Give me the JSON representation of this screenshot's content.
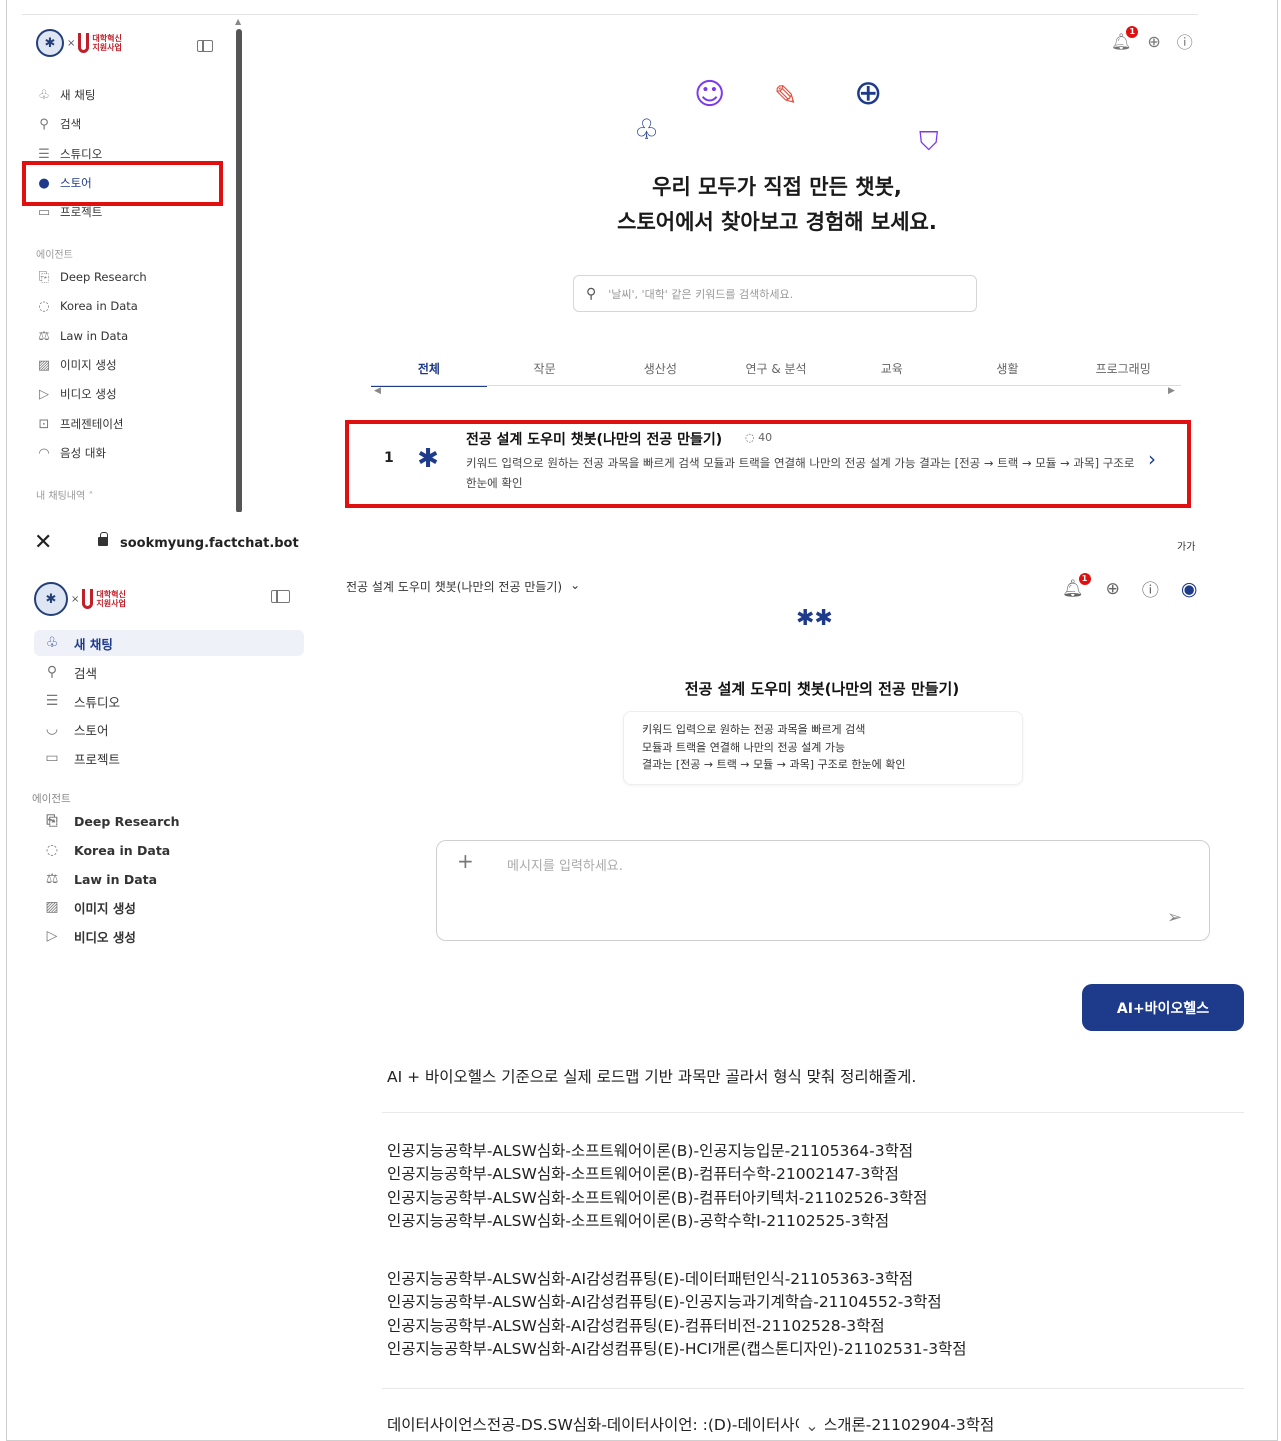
{
  "top_screen": {
    "sidebar": {
      "logo_text": "대학혁신\n지원사업",
      "items": [
        {
          "label": "새 채팅",
          "icon": "new-chat-icon"
        },
        {
          "label": "검색",
          "icon": "search-icon"
        },
        {
          "label": "스튜디오",
          "icon": "studio-icon"
        },
        {
          "label": "스토어",
          "icon": "store-icon",
          "active": true
        },
        {
          "label": "프로젝트",
          "icon": "folder-icon"
        }
      ],
      "agents_section": "에이전트",
      "agents": [
        {
          "label": "Deep Research",
          "icon": "deep-research-icon"
        },
        {
          "label": "Korea in Data",
          "icon": "korea-data-icon"
        },
        {
          "label": "Law in Data",
          "icon": "scale-icon"
        },
        {
          "label": "이미지 생성",
          "icon": "image-icon"
        },
        {
          "label": "비디오 생성",
          "icon": "video-icon"
        },
        {
          "label": "프레젠테이션",
          "icon": "presentation-icon"
        },
        {
          "label": "음성 대화",
          "icon": "voice-icon"
        }
      ],
      "history_section": "내 채팅내역"
    },
    "notification_count": "1",
    "hero_line1": "우리 모두가 직접 만든 챗봇,",
    "hero_line2": "스토어에서 찾아보고 경험해 보세요.",
    "search_placeholder": "'날씨', '대학' 같은 키워드를 검색하세요.",
    "tabs": [
      "전체",
      "작문",
      "생산성",
      "연구 & 분석",
      "교육",
      "생활",
      "프로그래밍"
    ],
    "result": {
      "rank": "1",
      "title": "전공 설계 도우미 챗봇(나만의 전공 만들기)",
      "count": "40",
      "description": "키워드 입력으로 원하는 전공 과목을 빠르게 검색 모듈과 트랙을 연결해 나만의 전공 설계 가능 결과는 [전공 → 트랙 → 모듈 → 과목] 구조로 한눈에 확인"
    }
  },
  "browser": {
    "url": "sookmyung.factchat.bot",
    "text_size_label": "가가"
  },
  "bottom_screen": {
    "sidebar": {
      "logo_text": "대학혁신\n지원사업",
      "items": [
        {
          "label": "새 채팅",
          "icon": "new-chat-icon",
          "active": true
        },
        {
          "label": "검색",
          "icon": "search-icon"
        },
        {
          "label": "스튜디오",
          "icon": "studio-icon"
        },
        {
          "label": "스토어",
          "icon": "store-icon"
        },
        {
          "label": "프로젝트",
          "icon": "folder-icon"
        }
      ],
      "agents_section": "에이전트",
      "agents": [
        {
          "label": "Deep Research",
          "icon": "deep-research-icon"
        },
        {
          "label": "Korea in Data",
          "icon": "korea-data-icon"
        },
        {
          "label": "Law in Data",
          "icon": "scale-icon"
        },
        {
          "label": "이미지 생성",
          "icon": "image-icon"
        },
        {
          "label": "비디오 생성",
          "icon": "video-icon"
        }
      ]
    },
    "header_title": "전공 설계 도우미 챗봇(나만의 전공 만들기)",
    "notification_count": "1",
    "bot_title": "전공 설계 도우미 챗봇(나만의 전공 만들기)",
    "bot_description": [
      "키워드 입력으로 원하는 전공 과목을 빠르게 검색",
      "모듈과 트랙을 연결해 나만의 전공 설계 가능",
      "결과는 [전공 → 트랙 → 모듈 → 과목] 구조로 한눈에 확인"
    ],
    "composer_placeholder": "메시지를 입력하세요.",
    "user_message": "AI+바이오헬스",
    "answer_intro": "AI + 바이오헬스 기준으로 실제 로드맵 기반 과목만 골라서 형식 맞춰 정리해줄게.",
    "course_group_1": [
      "인공지능공학부-ALSW심화-소프트웨어이론(B)-인공지능입문-21105364-3학점",
      "인공지능공학부-ALSW심화-소프트웨어이론(B)-컴퓨터수학-21002147-3학점",
      "인공지능공학부-ALSW심화-소프트웨어이론(B)-컴퓨터아키텍처-21102526-3학점",
      "인공지능공학부-ALSW심화-소프트웨어이론(B)-공학수학I-21102525-3학점"
    ],
    "course_group_2": [
      "인공지능공학부-ALSW심화-AI감성컴퓨팅(E)-데이터패턴인식-21105363-3학점",
      "인공지능공학부-ALSW심화-AI감성컴퓨팅(E)-인공지능과기계학습-21104552-3학점",
      "인공지능공학부-ALSW심화-AI감성컴퓨팅(E)-컴퓨터비전-21102528-3학점",
      "인공지능공학부-ALSW심화-AI감성컴퓨팅(E)-HCI개론(캡스톤디자인)-21102531-3학점"
    ],
    "course_partial": "데이터사이언스전공-DS.SW심화-데이터사이언:      :(D)-데이터사이언스개론-21102904-3학점"
  },
  "colors": {
    "accent": "#1e3a8a",
    "highlight": "#e01010"
  }
}
